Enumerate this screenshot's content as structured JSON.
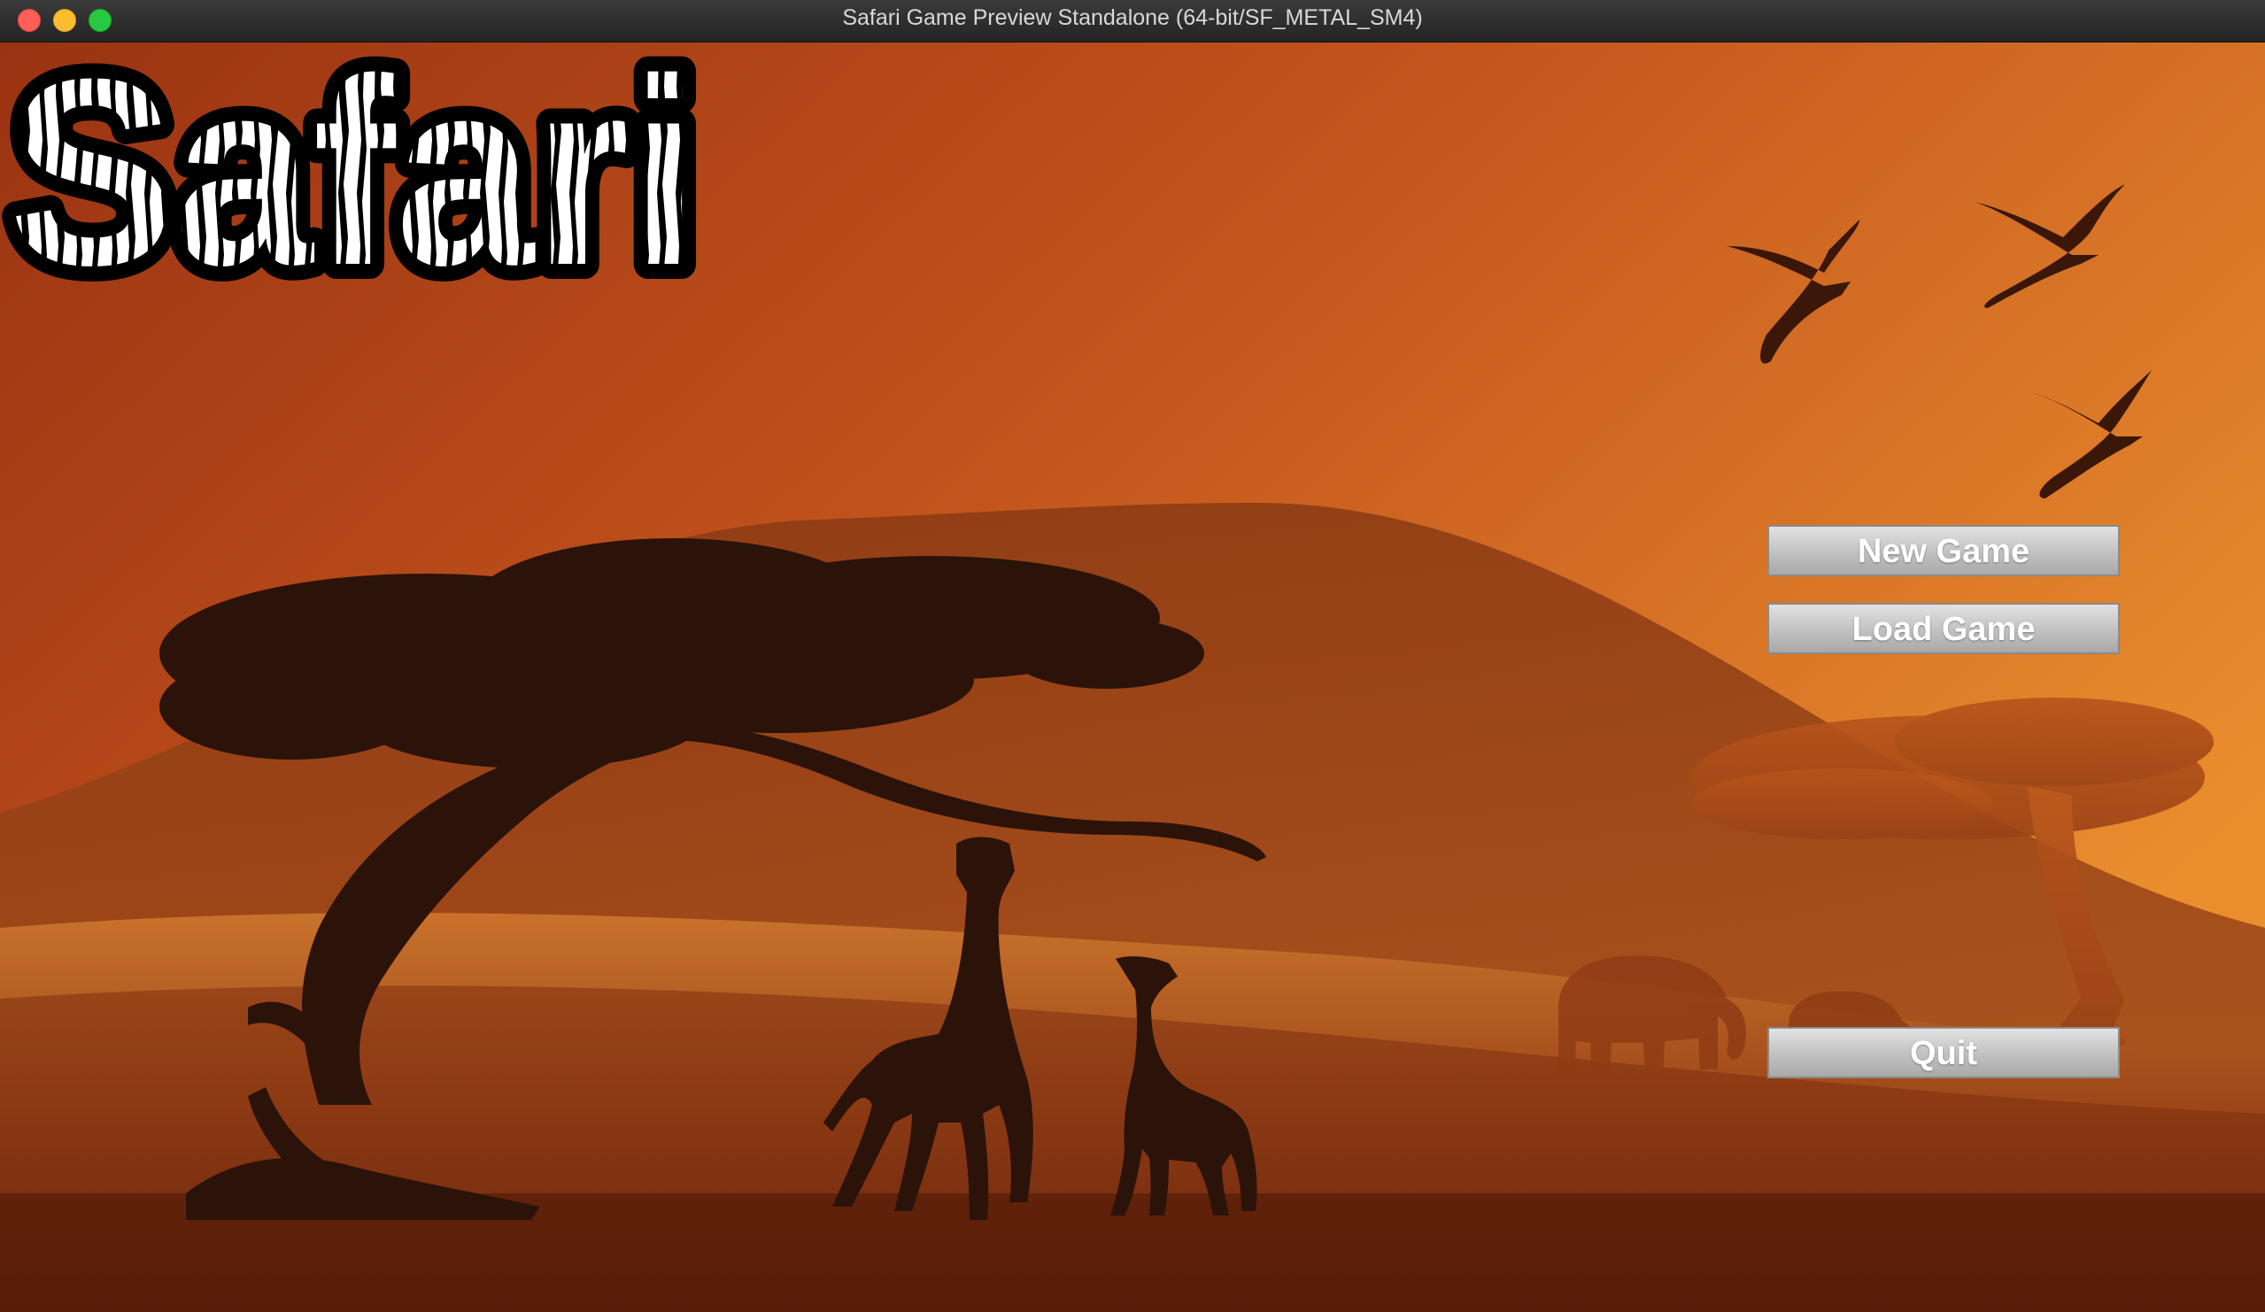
{
  "window": {
    "title": "Safari Game Preview Standalone (64-bit/SF_METAL_SM4)"
  },
  "game": {
    "logo_text": "Safari",
    "menu": {
      "new_game": "New Game",
      "load_game": "Load Game",
      "quit": "Quit"
    }
  },
  "colors": {
    "sky_top": "#a33a14",
    "sky_mid": "#c8561e",
    "sky_right": "#e8892c",
    "silhouette": "#2b1309",
    "hill": "#8e3e17",
    "button_text": "#ffffff"
  },
  "icons": {
    "close": "traffic-light-close",
    "minimize": "traffic-light-minimize",
    "maximize": "traffic-light-maximize"
  }
}
